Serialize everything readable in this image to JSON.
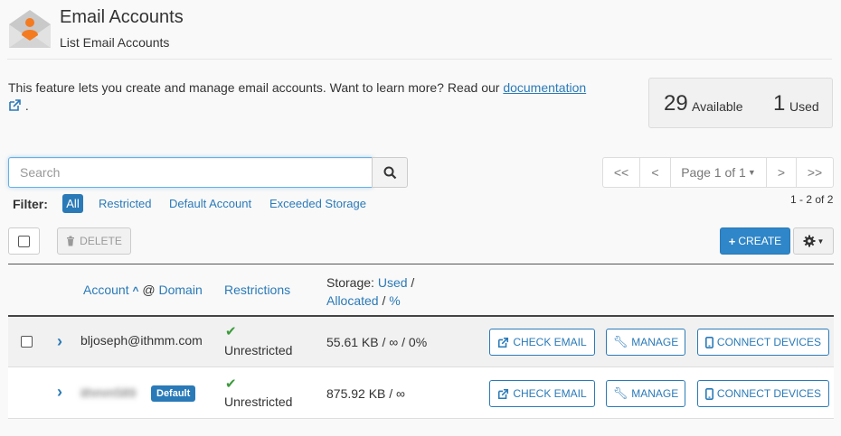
{
  "header": {
    "title": "Email Accounts",
    "subtitle": "List Email Accounts",
    "icon": "email-envelope-icon"
  },
  "intro": {
    "text": "This feature lets you create and manage email accounts. Want to learn more? Read our ",
    "link": "documentation",
    "suffix": "."
  },
  "stats": {
    "available_count": "29",
    "available_label": "Available",
    "used_count": "1",
    "used_label": "Used"
  },
  "search": {
    "placeholder": "Search",
    "value": ""
  },
  "pager": {
    "first": "<<",
    "prev": "<",
    "page": "Page 1 of 1",
    "next": ">",
    "last": ">>",
    "range": "1 - 2 of 2"
  },
  "filter": {
    "label": "Filter:",
    "options": [
      "All",
      "Restricted",
      "Default Account",
      "Exceeded Storage"
    ],
    "selected": "All"
  },
  "toolbar": {
    "delete_label": "DELETE",
    "create_label": "CREATE"
  },
  "table": {
    "headers": {
      "account": "Account",
      "at": "@",
      "domain": "Domain",
      "restrictions": "Restrictions",
      "storage": "Storage:",
      "used": "Used",
      "slash1": "/",
      "allocated": "Allocated",
      "slash2": "/",
      "percent": "%"
    },
    "rows": [
      {
        "account": "bljoseph@ithmm.com",
        "restriction": "Unrestricted",
        "storage": "55.61 KB / ∞ / 0%",
        "badge": ""
      },
      {
        "account": "ithmm589",
        "restriction": "Unrestricted",
        "storage": "875.92 KB / ∞",
        "badge": "Default"
      }
    ],
    "actions": {
      "check_email": "CHECK EMAIL",
      "manage": "MANAGE",
      "connect": "CONNECT DEVICES"
    }
  },
  "colors": {
    "accent": "#2a7ab8",
    "success": "#3c9a3c",
    "icon_orange": "#f47b20"
  }
}
